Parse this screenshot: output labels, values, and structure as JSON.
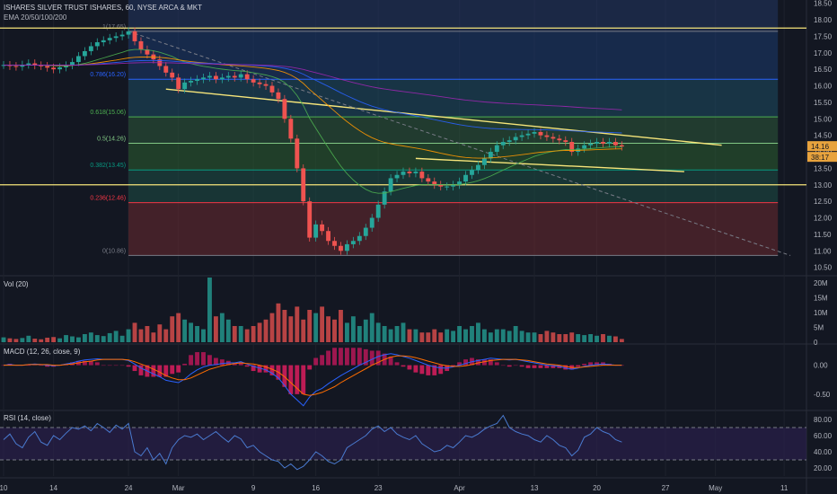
{
  "header": {
    "symbol_line": "ISHARES SILVER TRUST ISHARES, 60, NYSE ARCA & MKT",
    "ema_label": "EMA 20/50/100/200"
  },
  "panes": {
    "vol_label": "Vol (20)",
    "macd_label": "MACD (12, 26, close, 9)",
    "rsi_label": "RSI (14, close)"
  },
  "price_badges": {
    "last": "14.16",
    "countdown": "38:17"
  },
  "colors": {
    "background": "#131722",
    "up": "#26a69a",
    "down": "#ef5350",
    "trendline": "#f6e57a",
    "macd_line": "#2962ff",
    "signal_line": "#ff6d00",
    "rsi_line": "#4a7bd1",
    "badge": "#e8a33d"
  },
  "chart_data": [
    {
      "type": "candlestick",
      "pane": "price",
      "ylim": [
        10.3,
        18.6
      ],
      "y_ticks": [
        "10.50",
        "11.00",
        "11.50",
        "12.00",
        "12.50",
        "13.00",
        "13.50",
        "14.00",
        "14.50",
        "15.00",
        "15.50",
        "16.00",
        "16.50",
        "17.00",
        "17.50",
        "18.00",
        "18.50"
      ],
      "x_ticks": [
        "10",
        "14",
        "24",
        "Mar",
        "9",
        "16",
        "23",
        "Apr",
        "13",
        "20",
        "27",
        "May",
        "11"
      ],
      "x_tick_index": [
        0,
        8,
        20,
        28,
        40,
        50,
        60,
        73,
        85,
        95,
        106,
        114,
        125
      ],
      "close_series": [
        16.63,
        16.6,
        16.58,
        16.64,
        16.68,
        16.62,
        16.6,
        16.55,
        16.5,
        16.56,
        16.62,
        16.72,
        16.9,
        17.05,
        17.2,
        17.32,
        17.38,
        17.45,
        17.5,
        17.55,
        17.65,
        17.35,
        17.1,
        16.95,
        16.8,
        16.6,
        16.4,
        16.25,
        15.9,
        16.1,
        16.15,
        16.2,
        16.25,
        16.3,
        16.2,
        16.25,
        16.3,
        16.25,
        16.35,
        16.2,
        16.1,
        16.05,
        16.0,
        15.8,
        15.6,
        15.0,
        14.4,
        13.5,
        12.5,
        11.4,
        11.8,
        11.6,
        11.3,
        11.15,
        11.0,
        11.2,
        11.3,
        11.45,
        11.7,
        12.0,
        12.4,
        12.8,
        13.2,
        13.3,
        13.4,
        13.35,
        13.4,
        13.2,
        13.1,
        13.0,
        12.95,
        12.95,
        13.0,
        13.1,
        13.3,
        13.45,
        13.6,
        13.8,
        14.0,
        14.2,
        14.3,
        14.35,
        14.45,
        14.5,
        14.55,
        14.6,
        14.5,
        14.45,
        14.4,
        14.35,
        14.3,
        14.0,
        14.1,
        14.2,
        14.25,
        14.3,
        14.25,
        14.3,
        14.2,
        14.16
      ],
      "fib_levels": [
        {
          "label": "1(17.65)",
          "value": 17.65,
          "color": "#787b86"
        },
        {
          "label": "0.786(16.20)",
          "value": 16.2,
          "color": "#2962ff"
        },
        {
          "label": "0.618(15.06)",
          "value": 15.06,
          "color": "#4caf50"
        },
        {
          "label": "0.5(14.26)",
          "value": 14.26,
          "color": "#81c784"
        },
        {
          "label": "0.382(13.45)",
          "value": 13.45,
          "color": "#089981"
        },
        {
          "label": "0.236(12.46)",
          "value": 12.46,
          "color": "#f23645"
        },
        {
          "label": "0(10.86)",
          "value": 10.86,
          "color": "#787b86"
        }
      ],
      "horizontal_lines": [
        17.75,
        13.0
      ],
      "trendlines": [
        {
          "from": [
            26,
            15.9
          ],
          "to": [
            115,
            14.2
          ]
        },
        {
          "from": [
            66,
            13.8
          ],
          "to": [
            109,
            13.4
          ]
        },
        {
          "from": [
            20,
            17.65
          ],
          "to": [
            126,
            10.86
          ],
          "dashed": true
        }
      ]
    },
    {
      "type": "bar",
      "pane": "volume",
      "y_ticks": [
        "20M",
        "15M",
        "10M",
        "5M",
        "0"
      ],
      "ylim": [
        0,
        20
      ],
      "values": [
        1.5,
        1.2,
        1.0,
        1.3,
        2.0,
        1.1,
        0.9,
        1.4,
        1.6,
        1.2,
        2.2,
        1.8,
        1.5,
        2.5,
        3.0,
        2.2,
        1.9,
        2.8,
        3.5,
        2.0,
        4.0,
        6.0,
        4.0,
        5.0,
        3.0,
        5.5,
        4.0,
        8.0,
        9.0,
        7.0,
        6.0,
        5.0,
        4.0,
        20.0,
        8.0,
        9.0,
        7.0,
        5.0,
        5.0,
        4.0,
        5.0,
        6.0,
        7.0,
        9.0,
        12.0,
        10.0,
        8.0,
        11.0,
        7.0,
        10.0,
        9.0,
        11.0,
        8.0,
        7.0,
        10.0,
        6.0,
        8.0,
        5.0,
        7.0,
        9.0,
        6.0,
        5.0,
        4.0,
        5.0,
        6.0,
        4.0,
        4.0,
        3.0,
        3.0,
        4.0,
        3.0,
        4.0,
        3.5,
        5.0,
        4.0,
        5.0,
        6.0,
        4.0,
        3.0,
        4.0,
        4.0,
        3.5,
        5.0,
        3.5,
        3.0,
        3.0,
        2.5,
        3.5,
        3.0,
        2.5,
        2.5,
        3.0,
        2.5,
        2.2,
        2.5,
        2.0,
        2.5,
        2.0,
        1.8,
        1.0
      ]
    },
    {
      "type": "line",
      "pane": "macd",
      "y_ticks": [
        "0.00",
        "-0.50"
      ],
      "ylim": [
        -0.75,
        0.35
      ],
      "macd": [
        0.0,
        0.01,
        0.0,
        0.0,
        0.01,
        0.02,
        0.01,
        0.0,
        -0.01,
        0.0,
        0.02,
        0.04,
        0.07,
        0.09,
        0.1,
        0.11,
        0.1,
        0.1,
        0.1,
        0.1,
        0.08,
        0.02,
        -0.05,
        -0.1,
        -0.15,
        -0.2,
        -0.26,
        -0.28,
        -0.3,
        -0.24,
        -0.15,
        -0.08,
        -0.03,
        0.0,
        0.01,
        0.03,
        0.04,
        0.04,
        0.06,
        0.02,
        -0.02,
        -0.05,
        -0.08,
        -0.14,
        -0.22,
        -0.35,
        -0.5,
        -0.6,
        -0.7,
        -0.55,
        -0.45,
        -0.4,
        -0.32,
        -0.25,
        -0.18,
        -0.12,
        -0.06,
        0.0,
        0.05,
        0.1,
        0.15,
        0.18,
        0.2,
        0.18,
        0.15,
        0.12,
        0.08,
        0.04,
        0.0,
        -0.03,
        -0.05,
        -0.05,
        -0.03,
        0.0,
        0.03,
        0.06,
        0.08,
        0.1,
        0.12,
        0.11,
        0.1,
        0.09,
        0.1,
        0.08,
        0.06,
        0.04,
        0.02,
        0.0,
        -0.01,
        -0.02,
        -0.05,
        -0.07,
        -0.05,
        -0.02,
        0.0,
        0.01,
        0.02,
        0.01,
        0.0,
        0.0
      ],
      "signal": [
        0.0,
        0.0,
        0.0,
        0.0,
        0.01,
        0.01,
        0.01,
        0.01,
        0.0,
        0.0,
        0.01,
        0.02,
        0.04,
        0.06,
        0.07,
        0.09,
        0.1,
        0.1,
        0.1,
        0.1,
        0.09,
        0.06,
        0.02,
        -0.02,
        -0.07,
        -0.12,
        -0.18,
        -0.22,
        -0.25,
        -0.25,
        -0.22,
        -0.17,
        -0.12,
        -0.07,
        -0.04,
        -0.01,
        0.01,
        0.03,
        0.04,
        0.03,
        0.02,
        0.0,
        -0.03,
        -0.07,
        -0.12,
        -0.2,
        -0.3,
        -0.4,
        -0.5,
        -0.52,
        -0.5,
        -0.47,
        -0.42,
        -0.37,
        -0.3,
        -0.24,
        -0.18,
        -0.12,
        -0.06,
        0.0,
        0.05,
        0.1,
        0.14,
        0.16,
        0.16,
        0.15,
        0.13,
        0.1,
        0.07,
        0.04,
        0.01,
        -0.01,
        -0.02,
        -0.02,
        -0.01,
        0.01,
        0.04,
        0.06,
        0.08,
        0.09,
        0.1,
        0.1,
        0.1,
        0.09,
        0.08,
        0.06,
        0.04,
        0.02,
        0.01,
        0.0,
        -0.02,
        -0.04,
        -0.04,
        -0.03,
        -0.02,
        -0.01,
        0.0,
        0.0,
        0.0,
        0.0
      ]
    },
    {
      "type": "line",
      "pane": "rsi",
      "y_ticks": [
        "80.00",
        "60.00",
        "40.00",
        "20.00"
      ],
      "ylim": [
        10,
        90
      ],
      "bands": [
        70,
        30
      ],
      "values": [
        55,
        62,
        50,
        45,
        58,
        65,
        52,
        48,
        60,
        55,
        63,
        70,
        68,
        72,
        66,
        75,
        70,
        64,
        73,
        68,
        75,
        40,
        35,
        45,
        30,
        38,
        25,
        45,
        55,
        60,
        58,
        62,
        55,
        60,
        65,
        58,
        52,
        60,
        56,
        45,
        48,
        40,
        35,
        30,
        28,
        20,
        25,
        18,
        22,
        30,
        40,
        35,
        28,
        25,
        30,
        45,
        50,
        55,
        60,
        68,
        72,
        65,
        70,
        62,
        58,
        55,
        60,
        50,
        45,
        40,
        42,
        48,
        45,
        52,
        60,
        58,
        62,
        68,
        72,
        75,
        85,
        70,
        65,
        62,
        60,
        55,
        52,
        60,
        55,
        48,
        45,
        35,
        42,
        58,
        62,
        70,
        65,
        62,
        55,
        52
      ]
    }
  ]
}
